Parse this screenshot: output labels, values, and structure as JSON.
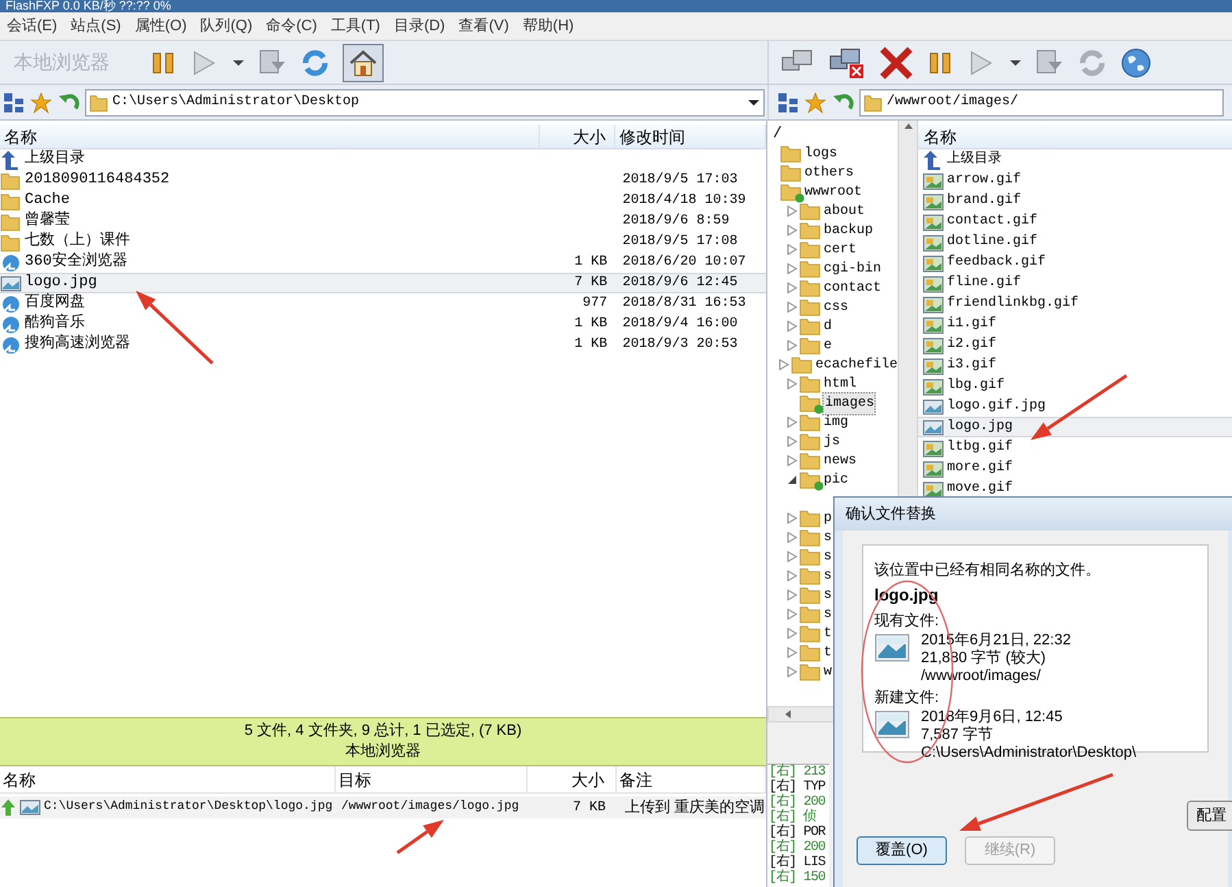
{
  "window": {
    "title": "FlashFXP 0.0 KB/秒 ??:?? 0%"
  },
  "menu": [
    "会话(E)",
    "站点(S)",
    "属性(O)",
    "队列(Q)",
    "命令(C)",
    "工具(T)",
    "目录(D)",
    "查看(V)",
    "帮助(H)"
  ],
  "left_pane": {
    "toolbar_label": "本地浏览器",
    "path": "C:\\Users\\Administrator\\Desktop",
    "columns": [
      "名称",
      "大小",
      "修改时间"
    ],
    "rows": [
      {
        "kind": "up",
        "name": "上级目录",
        "size": "",
        "modified": "",
        "selected": false
      },
      {
        "kind": "folder",
        "name": "2018090116484352",
        "size": "",
        "modified": "2018/9/5 17:03",
        "selected": false
      },
      {
        "kind": "folder",
        "name": "Cache",
        "size": "",
        "modified": "2018/4/18 10:39",
        "selected": false
      },
      {
        "kind": "folder",
        "name": "曾馨莹",
        "size": "",
        "modified": "2018/9/6 8:59",
        "selected": false
      },
      {
        "kind": "folder",
        "name": "七数（上）课件",
        "size": "",
        "modified": "2018/9/5 17:08",
        "selected": false
      },
      {
        "kind": "shortcut",
        "name": "360安全浏览器",
        "size": "1 KB",
        "modified": "2018/6/20 10:07",
        "selected": false
      },
      {
        "kind": "image",
        "name": "logo.jpg",
        "size": "7 KB",
        "modified": "2018/9/6 12:45",
        "selected": true
      },
      {
        "kind": "shortcut",
        "name": "百度网盘",
        "size": "977",
        "modified": "2018/8/31 16:53",
        "selected": false
      },
      {
        "kind": "shortcut",
        "name": "酷狗音乐",
        "size": "1 KB",
        "modified": "2018/9/4 16:00",
        "selected": false
      },
      {
        "kind": "shortcut",
        "name": "搜狗高速浏览器",
        "size": "1 KB",
        "modified": "2018/9/3 20:53",
        "selected": false
      }
    ]
  },
  "status": {
    "summary": "5 文件, 4 文件夹, 9 总计, 1 已选定, (7 KB)",
    "label": "本地浏览器"
  },
  "queue": {
    "columns": [
      "名称",
      "目标",
      "大小",
      "备注"
    ],
    "rows": [
      {
        "name": "C:\\Users\\Administrator\\Desktop\\logo.jpg",
        "target": "/wwwroot/images/logo.jpg",
        "size": "7 KB",
        "note": "上传到 重庆美的空调"
      }
    ]
  },
  "right_pane": {
    "path": "/wwwroot/images/",
    "tree": {
      "label": "/",
      "children": [
        {
          "label": "logs",
          "selected": false,
          "marked": false
        },
        {
          "label": "others",
          "selected": false,
          "marked": false
        },
        {
          "label": "wwwroot",
          "selected": false,
          "marked": true,
          "children": [
            {
              "label": "about",
              "expanded": false,
              "selected": false,
              "marked": false
            },
            {
              "label": "backup",
              "expanded": false,
              "selected": false,
              "marked": false
            },
            {
              "label": "cert",
              "expanded": false,
              "selected": false,
              "marked": false
            },
            {
              "label": "cgi-bin",
              "expanded": false,
              "selected": false,
              "marked": false
            },
            {
              "label": "contact",
              "expanded": false,
              "selected": false,
              "marked": false
            },
            {
              "label": "css",
              "expanded": false,
              "selected": false,
              "marked": false
            },
            {
              "label": "d",
              "expanded": false,
              "selected": false,
              "marked": false
            },
            {
              "label": "e",
              "expanded": false,
              "selected": false,
              "marked": false
            },
            {
              "label": "ecachefile",
              "expanded": false,
              "selected": false,
              "marked": false
            },
            {
              "label": "html",
              "expanded": false,
              "selected": false,
              "marked": false
            },
            {
              "label": "images",
              "selected": true,
              "marked": true
            },
            {
              "label": "img",
              "expanded": false,
              "selected": false,
              "marked": false
            },
            {
              "label": "js",
              "expanded": false,
              "selected": false,
              "marked": false
            },
            {
              "label": "news",
              "expanded": false,
              "selected": false,
              "marked": false
            },
            {
              "label": "pic",
              "expanded": true,
              "selected": false,
              "marked": true
            },
            {
              "label": "p",
              "expanded": false,
              "selected": false,
              "marked": false
            },
            {
              "label": "s",
              "expanded": false,
              "selected": false,
              "marked": false
            },
            {
              "label": "s",
              "expanded": false,
              "selected": false,
              "marked": false
            },
            {
              "label": "s",
              "expanded": false,
              "selected": false,
              "marked": false
            },
            {
              "label": "s",
              "expanded": false,
              "selected": false,
              "marked": false
            },
            {
              "label": "s",
              "expanded": false,
              "selected": false,
              "marked": false
            },
            {
              "label": "t",
              "expanded": false,
              "selected": false,
              "marked": false
            },
            {
              "label": "t",
              "expanded": false,
              "selected": false,
              "marked": false
            },
            {
              "label": "w",
              "expanded": false,
              "selected": false,
              "marked": false
            }
          ]
        }
      ]
    },
    "list": {
      "columns": [
        "名称"
      ],
      "rows": [
        {
          "kind": "up",
          "name": "上级目录",
          "selected": false
        },
        {
          "kind": "gif",
          "name": "arrow.gif",
          "selected": false
        },
        {
          "kind": "gif",
          "name": "brand.gif",
          "selected": false
        },
        {
          "kind": "gif",
          "name": "contact.gif",
          "selected": false
        },
        {
          "kind": "gif",
          "name": "dotline.gif",
          "selected": false
        },
        {
          "kind": "gif",
          "name": "feedback.gif",
          "selected": false
        },
        {
          "kind": "gif",
          "name": "fline.gif",
          "selected": false
        },
        {
          "kind": "gif",
          "name": "friendlinkbg.gif",
          "selected": false
        },
        {
          "kind": "gif",
          "name": "i1.gif",
          "selected": false
        },
        {
          "kind": "gif",
          "name": "i2.gif",
          "selected": false
        },
        {
          "kind": "gif",
          "name": "i3.gif",
          "selected": false
        },
        {
          "kind": "gif",
          "name": "lbg.gif",
          "selected": false
        },
        {
          "kind": "image",
          "name": "logo.gif.jpg",
          "selected": false
        },
        {
          "kind": "image",
          "name": "logo.jpg",
          "selected": true
        },
        {
          "kind": "gif",
          "name": "ltbg.gif",
          "selected": false
        },
        {
          "kind": "gif",
          "name": "more.gif",
          "selected": false
        },
        {
          "kind": "gif",
          "name": "move.gif",
          "selected": false
        }
      ]
    }
  },
  "log": [
    {
      "text": "[右] 213",
      "color": "#2f8a2f"
    },
    {
      "text": "[右] TYP",
      "color": "#111111"
    },
    {
      "text": "[右] 200",
      "color": "#2f8a2f"
    },
    {
      "text": "[右] 侦",
      "color": "#2f8a2f"
    },
    {
      "text": "[右] POR",
      "color": "#111111"
    },
    {
      "text": "[右] 200",
      "color": "#2f8a2f"
    },
    {
      "text": "[右] LIS",
      "color": "#111111"
    },
    {
      "text": "[右] 150",
      "color": "#2f8a2f"
    }
  ],
  "dialog": {
    "title": "确认文件替换",
    "message": "该位置中已经有相同名称的文件。",
    "filename": "logo.jpg",
    "files": [
      {
        "label": "现有文件:",
        "lines": [
          "2015年6月21日, 22:32",
          "21,880 字节 (较大)",
          "/wwwroot/images/"
        ]
      },
      {
        "label": "新建文件:",
        "lines": [
          "2018年9月6日, 12:45",
          "7,587 字节",
          "C:\\Users\\Administrator\\Desktop\\"
        ]
      }
    ],
    "config_button": "配置",
    "buttons": [
      {
        "label": "覆盖(O)",
        "disabled": false
      },
      {
        "label": "继续(R)",
        "disabled": true
      }
    ]
  }
}
